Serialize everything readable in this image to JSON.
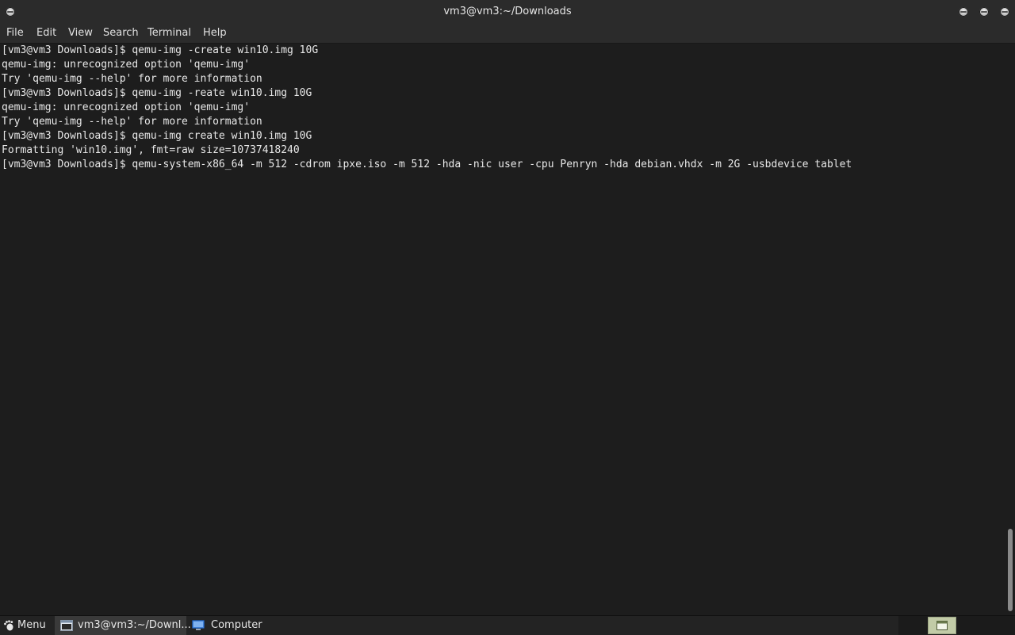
{
  "window": {
    "title": "vm3@vm3:~/Downloads"
  },
  "menubar": {
    "items": [
      "File",
      "Edit",
      "View",
      "Search",
      "Terminal",
      "Help"
    ]
  },
  "terminal": {
    "lines": [
      "[vm3@vm3 Downloads]$ qemu-img -create win10.img 10G",
      "qemu-img: unrecognized option 'qemu-img'",
      "Try 'qemu-img --help' for more information",
      "[vm3@vm3 Downloads]$ qemu-img -reate win10.img 10G",
      "qemu-img: unrecognized option 'qemu-img'",
      "Try 'qemu-img --help' for more information",
      "[vm3@vm3 Downloads]$ qemu-img create win10.img 10G",
      "Formatting 'win10.img', fmt=raw size=10737418240",
      "[vm3@vm3 Downloads]$ qemu-system-x86_64 -m 512 -cdrom ipxe.iso -m 512 -hda -nic user -cpu Penryn -hda debian.vhdx -m 2G -usbdevice tablet"
    ]
  },
  "scrollbar": {
    "position_fraction": 1.0
  },
  "taskbar": {
    "menu_label": "Menu",
    "window_label": "vm3@vm3:~/Downl...",
    "computer_label": "Computer"
  },
  "icons": {
    "window_menu": "window-menu-icon",
    "minimize": "minimize-icon",
    "maximize": "maximize-icon",
    "close": "close-icon",
    "menu": "gnome-foot-icon",
    "terminal": "terminal-window-icon",
    "computer": "computer-icon",
    "show_desktop": "show-desktop-icon"
  }
}
